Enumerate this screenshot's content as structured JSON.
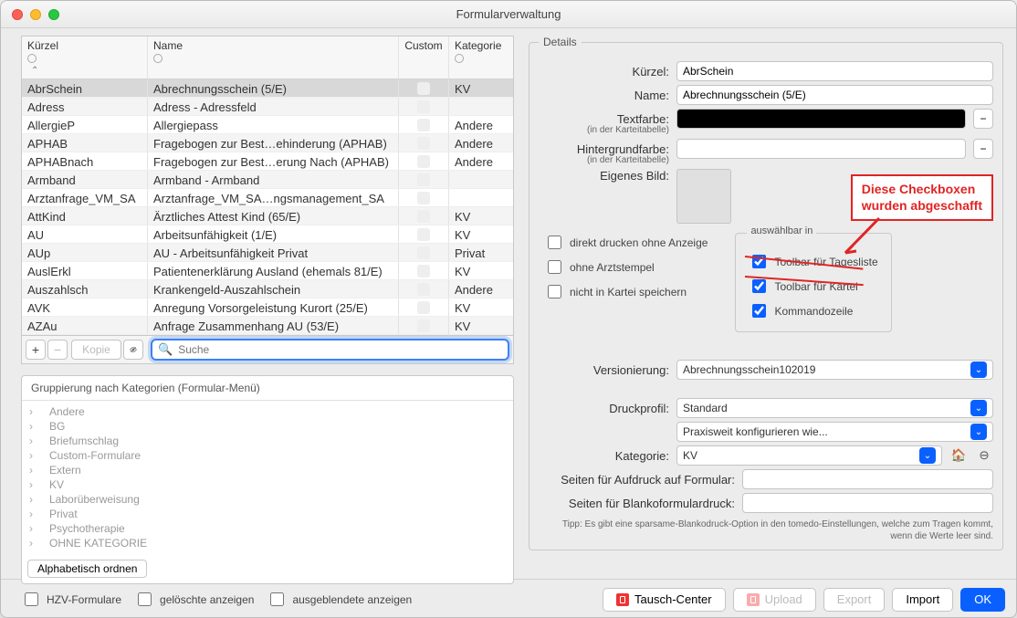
{
  "window_title": "Formularverwaltung",
  "table": {
    "headers": {
      "kuerzel": "Kürzel",
      "name": "Name",
      "custom": "Custom",
      "kategorie": "Kategorie"
    },
    "rows": [
      {
        "kuerzel": "AbrSchein",
        "name": "Abrechnungsschein (5/E)",
        "kategorie": "KV",
        "selected": true
      },
      {
        "kuerzel": "Adress",
        "name": "Adress - Adressfeld",
        "kategorie": ""
      },
      {
        "kuerzel": "AllergieP",
        "name": "Allergiepass",
        "kategorie": "Andere"
      },
      {
        "kuerzel": "APHAB",
        "name": "Fragebogen zur Best…ehinderung (APHAB)",
        "kategorie": "Andere"
      },
      {
        "kuerzel": "APHABnach",
        "name": "Fragebogen zur Best…erung Nach (APHAB)",
        "kategorie": "Andere"
      },
      {
        "kuerzel": "Armband",
        "name": "Armband - Armband",
        "kategorie": ""
      },
      {
        "kuerzel": "Arztanfrage_VM_SA",
        "name": "Arztanfrage_VM_SA…ngsmanagement_SA",
        "kategorie": ""
      },
      {
        "kuerzel": "AttKind",
        "name": "Ärztliches Attest Kind (65/E)",
        "kategorie": "KV"
      },
      {
        "kuerzel": "AU",
        "name": "Arbeitsunfähigkeit (1/E)",
        "kategorie": "KV"
      },
      {
        "kuerzel": "AUp",
        "name": "AU - Arbeitsunfähigkeit Privat",
        "kategorie": "Privat"
      },
      {
        "kuerzel": "AuslErkl",
        "name": "Patientenerklärung Ausland (ehemals 81/E)",
        "kategorie": "KV"
      },
      {
        "kuerzel": "Auszahlsch",
        "name": "Krankengeld-Auszahlschein",
        "kategorie": "Andere"
      },
      {
        "kuerzel": "AVK",
        "name": "Anregung Vorsorgeleistung Kurort (25/E)",
        "kategorie": "KV"
      },
      {
        "kuerzel": "AZAu",
        "name": "Anfrage Zusammenhang AU (53/E)",
        "kategorie": "KV"
      }
    ]
  },
  "toolbar": {
    "plus": "+",
    "minus": "−",
    "kopie": "Kopie",
    "eye": "👁",
    "search_placeholder": "Suche"
  },
  "categories": {
    "title": "Gruppierung nach Kategorien (Formular-Menü)",
    "items": [
      "Andere",
      "BG",
      "Briefumschlag",
      "Custom-Formulare",
      "Extern",
      "KV",
      "Laborüberweisung",
      "Privat",
      "Psychotherapie",
      "OHNE KATEGORIE"
    ],
    "alpha_btn": "Alphabetisch ordnen"
  },
  "footer": {
    "hzv": "HZV-Formulare",
    "deleted": "gelöschte anzeigen",
    "hidden": "ausgeblendete anzeigen",
    "tausch": "Tausch-Center",
    "upload": "Upload",
    "export": "Export",
    "import": "Import",
    "ok": "OK"
  },
  "details": {
    "legend": "Details",
    "kuerzel_lbl": "Kürzel:",
    "kuerzel": "AbrSchein",
    "name_lbl": "Name:",
    "name": "Abrechnungsschein (5/E)",
    "textfarbe_lbl": "Textfarbe:",
    "kartei_hint": "(in der Karteitabelle)",
    "bgfarbe_lbl": "Hintergrundfarbe:",
    "bild_lbl": "Eigenes Bild:",
    "cb_direct": "direkt drucken ohne Anzeige",
    "cb_stempel": "ohne Arztstempel",
    "cb_nokartei": "nicht in Kartei speichern",
    "sel_title": "auswählbar in",
    "cb_tages": "Toolbar für Tagesliste",
    "cb_kartei": "Toolbar für Kartei",
    "cb_kommando": "Kommandozeile",
    "version_lbl": "Versionierung:",
    "version": "Abrechnungsschein102019",
    "druck_lbl": "Druckprofil:",
    "druck": "Standard",
    "praxis": "Praxisweit konfigurieren wie...",
    "kat_lbl": "Kategorie:",
    "kat": "KV",
    "aufdruck_lbl": "Seiten für Aufdruck auf Formular:",
    "blanko_lbl": "Seiten für Blankoformulardruck:",
    "tip": "Tipp: Es gibt eine sparsame-Blankodruck-Option in den tomedo-Einstellungen, welche zum Tragen kommt, wenn die Werte leer sind."
  },
  "annotation": {
    "l1": "Diese Checkboxen",
    "l2": "wurden abgeschafft"
  }
}
